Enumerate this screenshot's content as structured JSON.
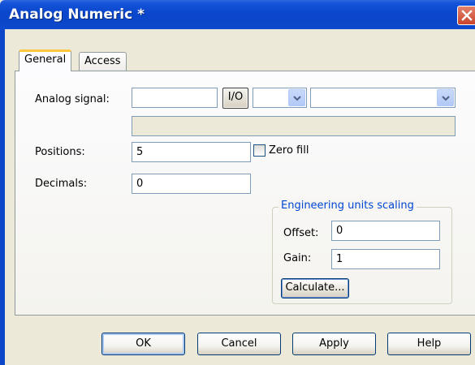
{
  "window": {
    "title": "Analog Numeric *",
    "title_bar_color": "#0B47C8",
    "close_icon": "close-icon"
  },
  "tabs": [
    {
      "label": "General",
      "active": true
    },
    {
      "label": "Access",
      "active": false
    }
  ],
  "general": {
    "analog_signal_label": "Analog signal:",
    "analog_signal_value": "",
    "io_button_label": "I/O",
    "combo1_value": "",
    "combo2_value": "",
    "signal_description_value": "",
    "positions_label": "Positions:",
    "positions_value": "5",
    "zero_fill_label": "Zero fill",
    "zero_fill_checked": false,
    "decimals_label": "Decimals:",
    "decimals_value": "0"
  },
  "scaling": {
    "group_title": "Engineering units scaling",
    "group_title_color": "#0046D5",
    "offset_label": "Offset:",
    "offset_value": "0",
    "gain_label": "Gain:",
    "gain_value": "1",
    "calculate_label": "Calculate..."
  },
  "footer": {
    "ok_label": "OK",
    "cancel_label": "Cancel",
    "apply_label": "Apply",
    "help_label": "Help"
  }
}
